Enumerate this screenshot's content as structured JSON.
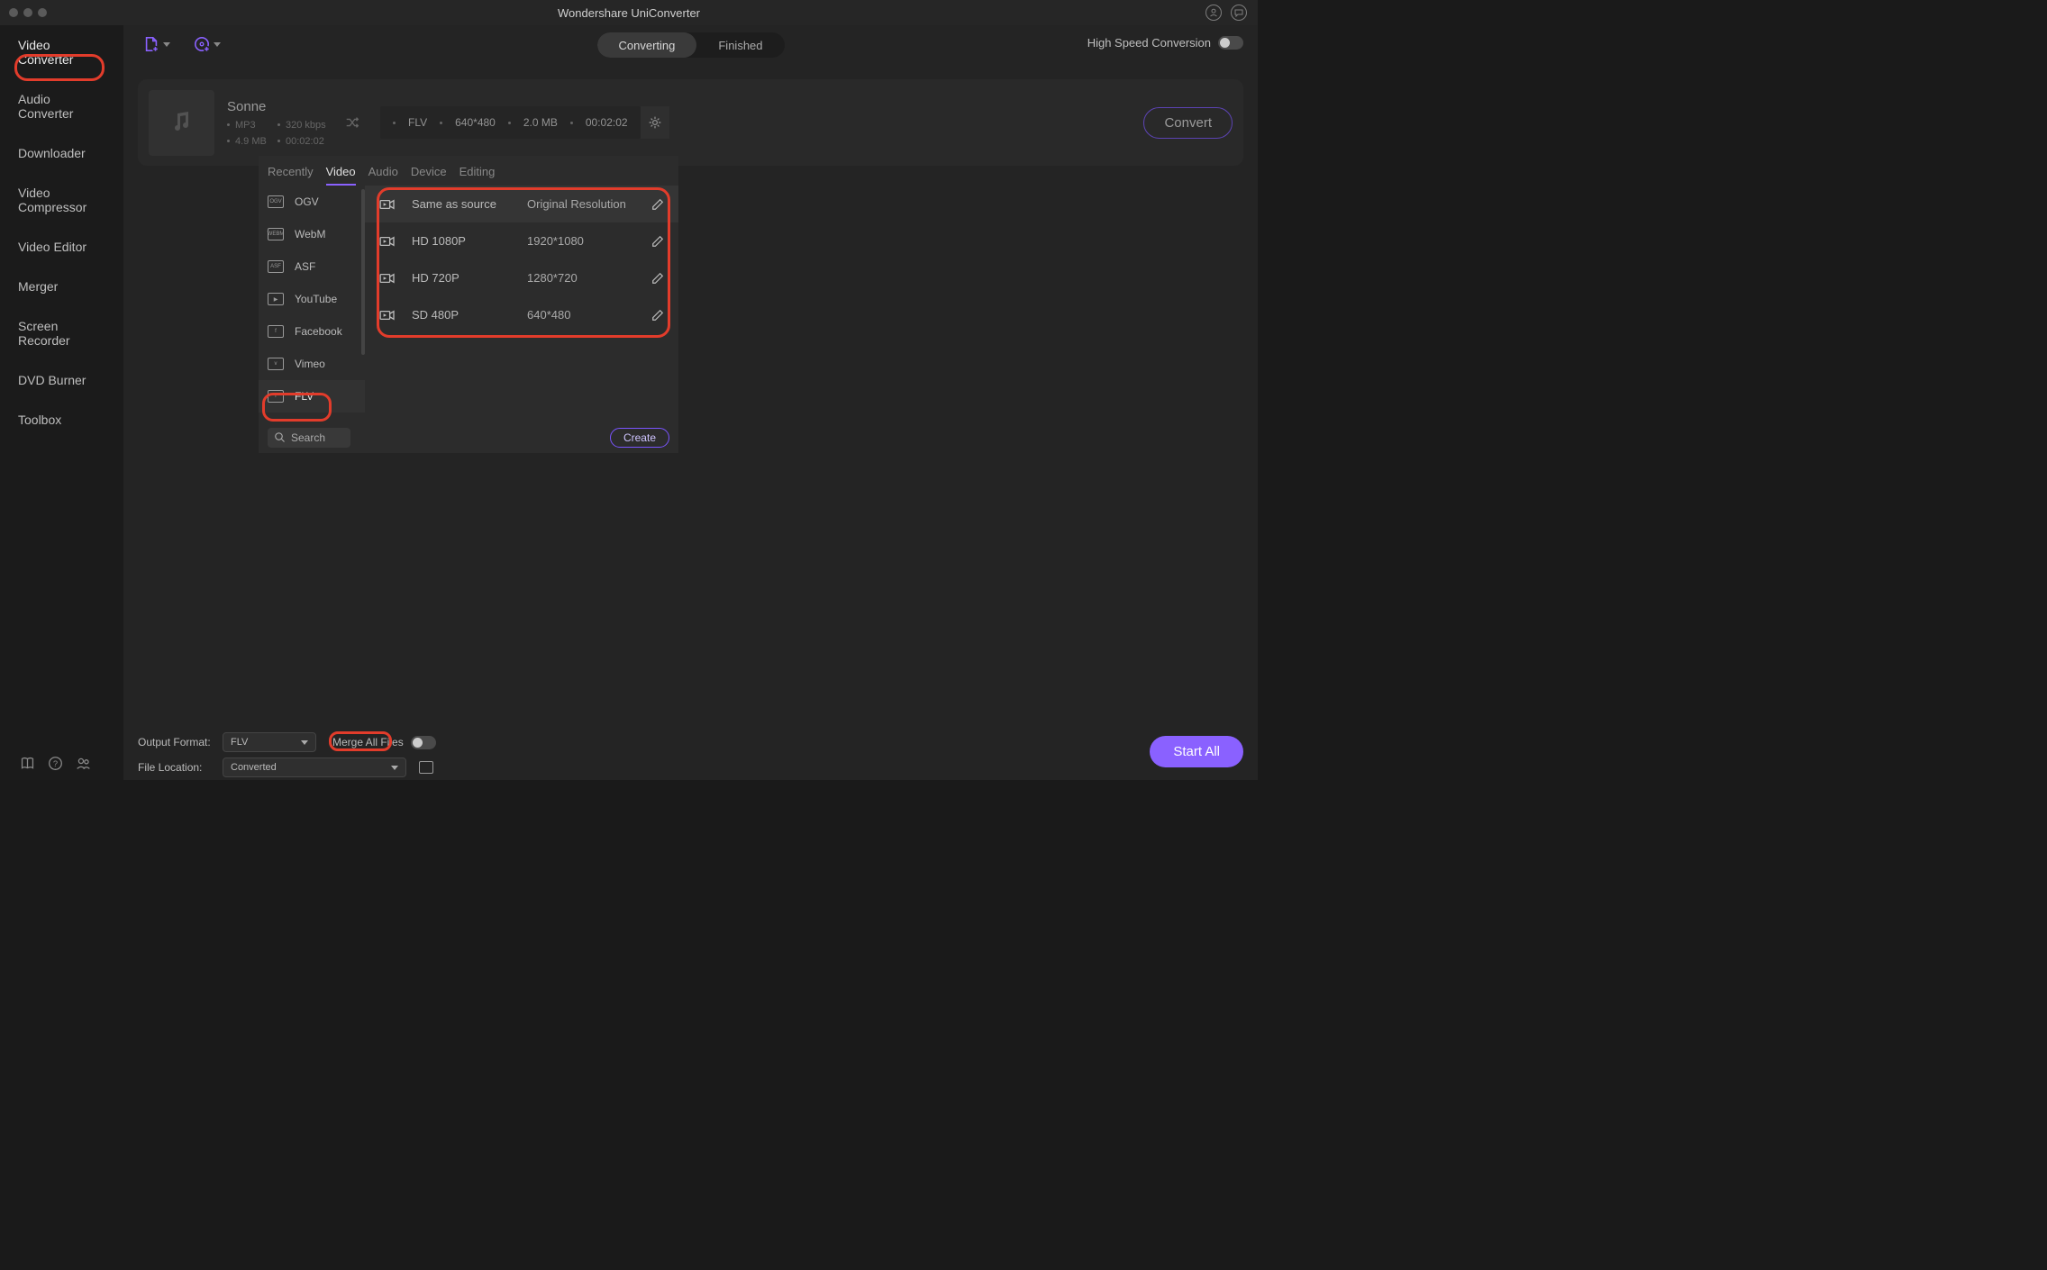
{
  "titlebar": {
    "title": "Wondershare UniConverter"
  },
  "sidebar": {
    "items": [
      {
        "label": "Video Converter"
      },
      {
        "label": "Audio Converter"
      },
      {
        "label": "Downloader"
      },
      {
        "label": "Video Compressor"
      },
      {
        "label": "Video Editor"
      },
      {
        "label": "Merger"
      },
      {
        "label": "Screen Recorder"
      },
      {
        "label": "DVD Burner"
      },
      {
        "label": "Toolbox"
      }
    ]
  },
  "toolbar": {
    "tabs": {
      "converting": "Converting",
      "finished": "Finished"
    },
    "high_speed_label": "High Speed Conversion"
  },
  "media_item": {
    "name": "Sonne",
    "src_format": "MP3",
    "src_bitrate": "320 kbps",
    "src_size": "4.9 MB",
    "src_duration": "00:02:02",
    "out_format": "FLV",
    "out_res": "640*480",
    "out_size": "2.0 MB",
    "out_duration": "00:02:02",
    "convert_label": "Convert"
  },
  "picker": {
    "tabs": {
      "recently": "Recently",
      "video": "Video",
      "audio": "Audio",
      "device": "Device",
      "editing": "Editing"
    },
    "formats": [
      {
        "label": "OGV"
      },
      {
        "label": "WebM"
      },
      {
        "label": "ASF"
      },
      {
        "label": "YouTube"
      },
      {
        "label": "Facebook"
      },
      {
        "label": "Vimeo"
      },
      {
        "label": "FLV"
      }
    ],
    "resolutions": [
      {
        "label": "Same as source",
        "value": "Original Resolution"
      },
      {
        "label": "HD 1080P",
        "value": "1920*1080"
      },
      {
        "label": "HD 720P",
        "value": "1280*720"
      },
      {
        "label": "SD 480P",
        "value": "640*480"
      }
    ],
    "search_placeholder": "Search",
    "create_label": "Create"
  },
  "bottom": {
    "output_format_label": "Output Format:",
    "output_format_value": "FLV",
    "merge_label": "Merge All Files",
    "file_location_label": "File Location:",
    "file_location_value": "Converted",
    "start_all_label": "Start All"
  }
}
